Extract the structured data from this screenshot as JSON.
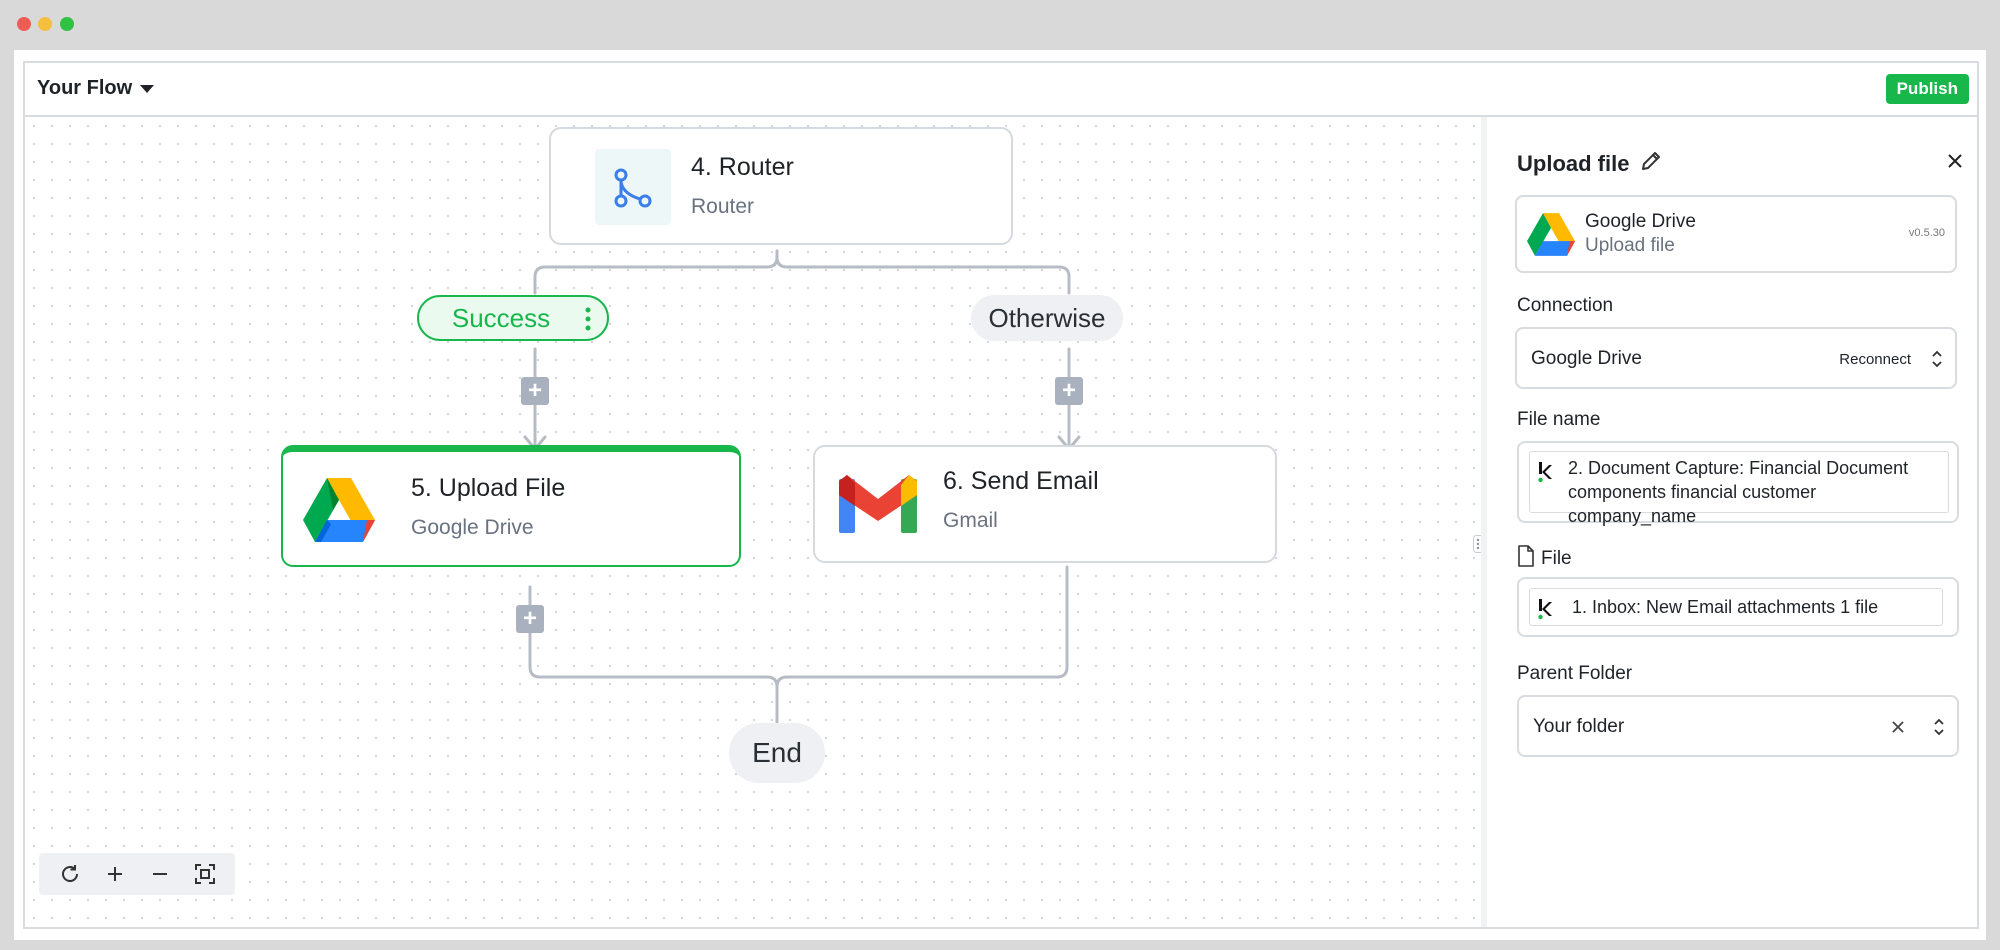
{
  "header": {
    "flow_title": "Your Flow",
    "publish_label": "Publish"
  },
  "nodes": {
    "router": {
      "title": "4. Router",
      "subtitle": "Router"
    },
    "upload": {
      "title": "5. Upload File",
      "subtitle": "Google Drive"
    },
    "email": {
      "title": "6. Send Email",
      "subtitle": "Gmail"
    }
  },
  "branches": {
    "success": "Success",
    "otherwise": "Otherwise",
    "end": "End"
  },
  "panel": {
    "title": "Upload file",
    "app": {
      "name": "Google Drive",
      "action": "Upload file",
      "version": "v0.5.30"
    },
    "connection": {
      "label": "Connection",
      "value": "Google Drive",
      "reconnect": "Reconnect"
    },
    "file_name": {
      "label": "File name",
      "value": "2. Document Capture: Financial Document components financial customer company_name"
    },
    "file": {
      "label": "File",
      "value": "1.  Inbox: New Email attachments 1 file"
    },
    "parent_folder": {
      "label": "Parent Folder",
      "value": "Your folder"
    }
  },
  "colors": {
    "success": "#18b74c",
    "publish": "#18b74c",
    "router_icon": "#3b7de9"
  },
  "icons": [
    "chevron-down-icon",
    "router-icon",
    "google-drive-icon",
    "gmail-icon",
    "plus-icon",
    "pencil-icon",
    "close-icon",
    "sort-arrows-icon",
    "file-icon",
    "refresh-icon",
    "zoom-in-icon",
    "zoom-out-icon",
    "fit-view-icon",
    "more-vertical-icon",
    "drag-handle-icon"
  ]
}
